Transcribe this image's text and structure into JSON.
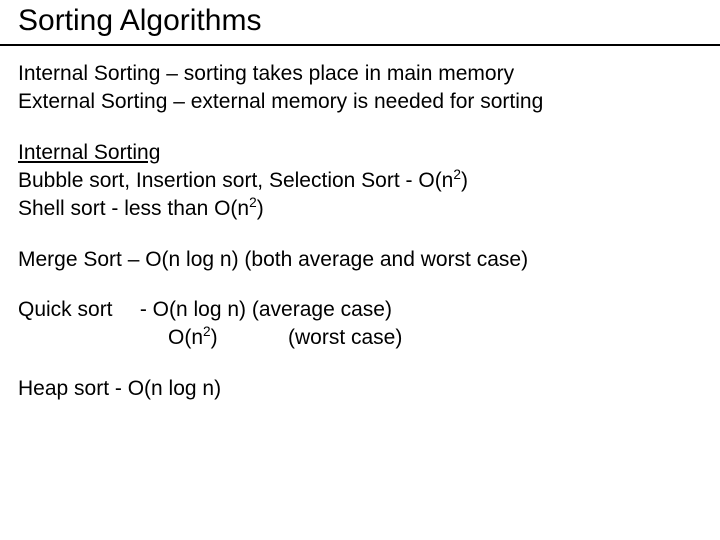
{
  "title": "Sorting Algorithms",
  "defs": {
    "internal": "Internal Sorting – sorting takes place in main memory",
    "external": "External Sorting – external memory is needed for sorting"
  },
  "section": {
    "heading": "Internal Sorting",
    "line1a": "Bubble sort, Insertion sort, Selection Sort  - O(n",
    "line1b": ")",
    "line2a": "Shell sort  - less than O(n",
    "line2b": ")"
  },
  "merge": "Merge Sort – O(n log n) (both average and worst case)",
  "quick": {
    "label": "Quick sort",
    "avg": "- O(n log n) (average case)",
    "worst_a": "O(n",
    "worst_b": ")",
    "worst_c": "(worst case)"
  },
  "heap": "Heap sort  -  O(n log n)",
  "sup2": "2"
}
